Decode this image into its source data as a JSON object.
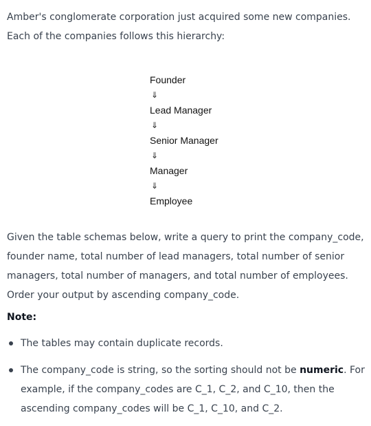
{
  "intro": "Amber's conglomerate corporation just acquired some new companies. Each of the companies follows this hierarchy:",
  "hierarchy": {
    "levels": [
      "Founder",
      "Lead Manager",
      "Senior Manager",
      "Manager",
      "Employee"
    ],
    "arrow": "⇓"
  },
  "description": "Given the table schemas below, write a query to print the company_code, founder name, total number of lead managers, total number of senior managers, total number of managers, and total number of employees. Order your output by ascending company_code.",
  "note": {
    "label": "Note:",
    "items": [
      "The tables may contain duplicate records.",
      {
        "before": "The company_code is string, so the sorting should not be ",
        "bold": "numeric",
        "after": ". For example, if the company_codes are C_1, C_2, and C_10, then the ascending company_codes will be C_1, C_10, and C_2."
      }
    ]
  }
}
